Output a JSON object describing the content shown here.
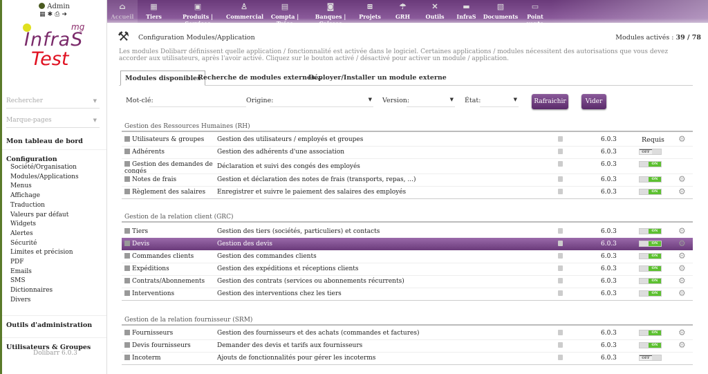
{
  "user": {
    "name": "Admin",
    "icons": [
      "calculator-icon",
      "bug-icon",
      "print-icon",
      "logout-icon"
    ]
  },
  "logo": {
    "mg": "mg",
    "line1": "InfraS",
    "line2": "Test"
  },
  "sidebar": {
    "search_placeholder": "Rechercher",
    "bookmarks_placeholder": "Marque-pages",
    "dashboard": "Mon tableau de bord",
    "config_title": "Configuration",
    "config_items": [
      "Société/Organisation",
      "Modules/Applications",
      "Menus",
      "Affichage",
      "Traduction",
      "Valeurs par défaut",
      "Widgets",
      "Alertes",
      "Sécurité",
      "Limites et précision",
      "PDF",
      "Emails",
      "SMS",
      "Dictionnaires",
      "Divers"
    ],
    "admin_tools": "Outils d'administration",
    "users_groups": "Utilisateurs & Groupes",
    "version": "Dolibarr 6.0.3"
  },
  "topnav": [
    {
      "label": "Accueil",
      "icon": "⌂"
    },
    {
      "label": "Tiers",
      "icon": "▦"
    },
    {
      "label": "Produits | Services",
      "icon": "▣"
    },
    {
      "label": "Commercial",
      "icon": "♙"
    },
    {
      "label": "Compta | Tréso",
      "icon": "▤"
    },
    {
      "label": "Banques | Caisses",
      "icon": "◙"
    },
    {
      "label": "Projets",
      "icon": "⊞"
    },
    {
      "label": "GRH",
      "icon": "☂"
    },
    {
      "label": "Outils",
      "icon": "✕"
    },
    {
      "label": "InfraS",
      "icon": "▬"
    },
    {
      "label": "Documents",
      "icon": "▧"
    },
    {
      "label": "Point vente",
      "icon": "▭"
    }
  ],
  "page": {
    "title": "Configuration Modules/Application",
    "count_label": "Modules activés :",
    "count": "39 / 78",
    "description": "Les modules Dolibarr définissent quelle application / fonctionnalité est activée dans le logiciel. Certaines applications / modules nécessitent des autorisations que vous devez accorder aux utilisateurs, après l'avoir activé. Cliquez sur le bouton activé / désactivé pour activer un module / application."
  },
  "tabs": [
    "Modules disponibles",
    "Recherche de modules externes...",
    "Déployer/Installer un module externe"
  ],
  "filters": {
    "keyword": "Mot-clé:",
    "keyword_value": "",
    "origin": "Origine:",
    "version": "Version:",
    "state": "État:",
    "refresh": "Rafraichir",
    "clear": "Vider"
  },
  "groups": [
    {
      "title": "Gestion des Ressources Humaines (RH)",
      "modules": [
        {
          "name": "Utilisateurs & groupes",
          "desc": "Gestion des utilisateurs / employés et groupes",
          "version": "6.0.3",
          "status": "Requis",
          "gear": true
        },
        {
          "name": "Adhérents",
          "desc": "Gestion des adhérents d'une association",
          "version": "6.0.3",
          "status": "OFF",
          "gear": false
        },
        {
          "name": "Gestion des demandes de congés",
          "desc": "Déclaration et suivi des congés des employés",
          "version": "6.0.3",
          "status": "ON",
          "gear": false
        },
        {
          "name": "Notes de frais",
          "desc": "Gestion et déclaration des notes de frais (transports, repas, ...)",
          "version": "6.0.3",
          "status": "ON",
          "gear": true
        },
        {
          "name": "Règlement des salaires",
          "desc": "Enregistrer et suivre le paiement des salaires des employés",
          "version": "6.0.3",
          "status": "ON",
          "gear": true
        }
      ]
    },
    {
      "title": "Gestion de la relation client (GRC)",
      "modules": [
        {
          "name": "Tiers",
          "desc": "Gestion des tiers (sociétés, particuliers) et contacts",
          "version": "6.0.3",
          "status": "ON",
          "gear": true
        },
        {
          "name": "Devis",
          "desc": "Gestion des devis",
          "version": "6.0.3",
          "status": "ON",
          "gear": true,
          "highlight": true
        },
        {
          "name": "Commandes clients",
          "desc": "Gestion des commandes clients",
          "version": "6.0.3",
          "status": "ON",
          "gear": true
        },
        {
          "name": "Expéditions",
          "desc": "Gestion des expéditions et réceptions clients",
          "version": "6.0.3",
          "status": "ON",
          "gear": true
        },
        {
          "name": "Contrats/Abonnements",
          "desc": "Gestion des contrats (services ou abonnements récurrents)",
          "version": "6.0.3",
          "status": "ON",
          "gear": true
        },
        {
          "name": "Interventions",
          "desc": "Gestion des interventions chez les tiers",
          "version": "6.0.3",
          "status": "ON",
          "gear": true
        }
      ]
    },
    {
      "title": "Gestion de la relation fournisseur (SRM)",
      "modules": [
        {
          "name": "Fournisseurs",
          "desc": "Gestion des fournisseurs et des achats (commandes et factures)",
          "version": "6.0.3",
          "status": "ON",
          "gear": true
        },
        {
          "name": "Devis fournisseurs",
          "desc": "Demander des devis et tarifs aux fournisseurs",
          "version": "6.0.3",
          "status": "ON",
          "gear": true
        },
        {
          "name": "Incoterm",
          "desc": "Ajouts de fonctionnalités pour gérer les incoterms",
          "version": "6.0.3",
          "status": "OFF",
          "gear": false
        }
      ]
    }
  ],
  "colors": {
    "accent": "#6a3a7a",
    "on": "#5cc030",
    "logo_red": "#e01020"
  }
}
